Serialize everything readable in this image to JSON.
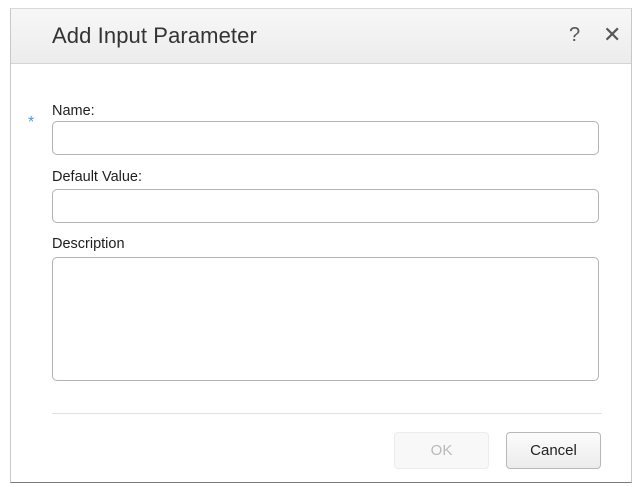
{
  "dialog": {
    "title": "Add Input Parameter",
    "help_glyph": "?",
    "close_glyph": "✕",
    "required_marker": "*",
    "accent_color": "#4f9ad8"
  },
  "form": {
    "name_label": "Name:",
    "name_value": "",
    "default_value_label": "Default Value:",
    "default_value_value": "",
    "description_label": "Description",
    "description_value": ""
  },
  "buttons": {
    "ok_label": "OK",
    "ok_enabled": false,
    "cancel_label": "Cancel"
  }
}
